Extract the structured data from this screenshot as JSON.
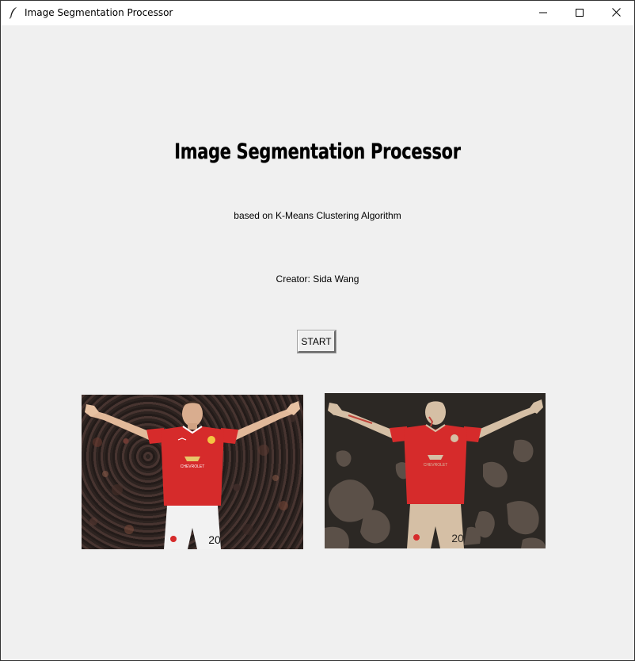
{
  "window": {
    "title": "Image Segmentation Processor",
    "icons": {
      "app": "feather-icon",
      "minimize": "minimize-icon",
      "maximize": "maximize-icon",
      "close": "close-icon"
    }
  },
  "main": {
    "heading": "Image Segmentation Processor",
    "subtitle": "based on K-Means Clustering Algorithm",
    "creator": "Creator: Sida Wang",
    "start_label": "START"
  },
  "images": {
    "original": {
      "shirt_sponsor": "CHEVROLET",
      "number": "20"
    },
    "segmented": {
      "shirt_sponsor": "CHEVROLET",
      "number": "20"
    }
  },
  "colors": {
    "window_bg": "#f0f0f0",
    "shirt_red": "#d62b2b",
    "segment_dark": "#2c2824",
    "segment_mid": "#5b5048",
    "segment_skin": "#d5bfa5"
  }
}
